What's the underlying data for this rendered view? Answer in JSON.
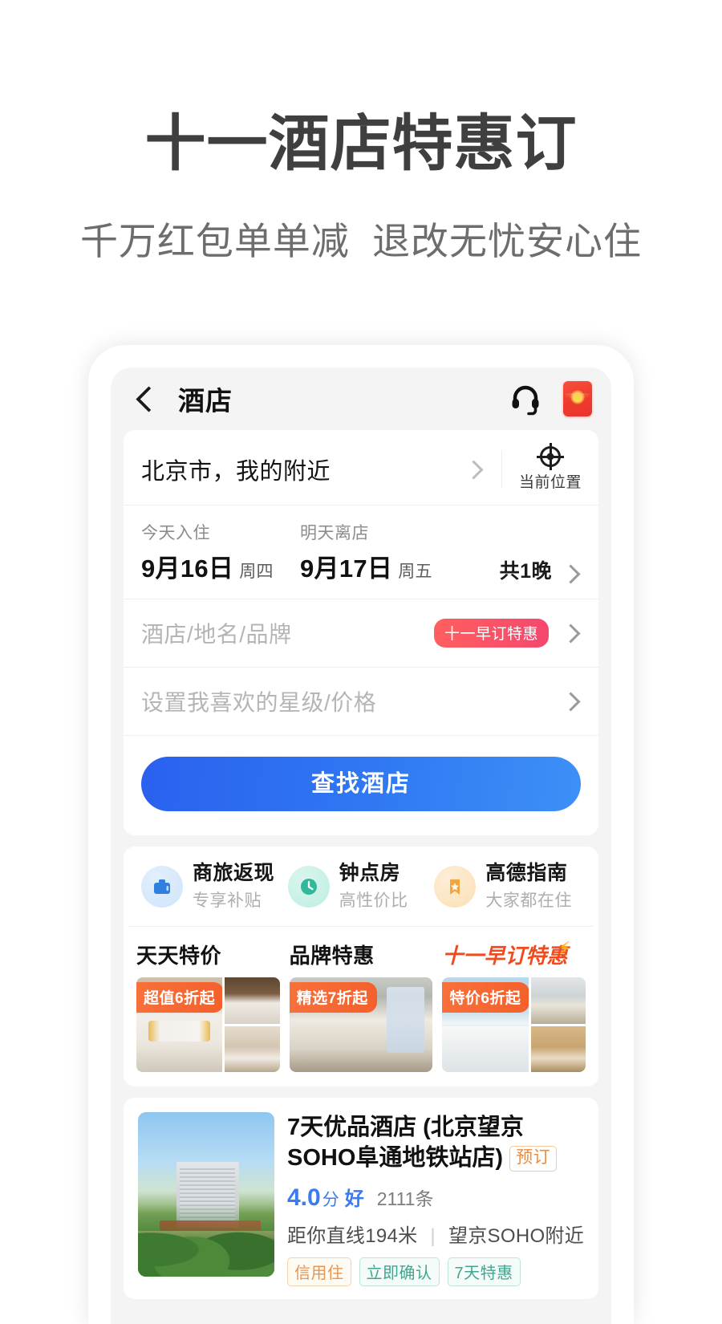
{
  "hero": {
    "title": "十一酒店特惠订",
    "subtitle": "千万红包单单减  退改无忧安心住"
  },
  "appbar": {
    "title": "酒店",
    "back_icon": "back-arrow-icon",
    "service_icon": "headset-icon",
    "redpacket_icon": "red-envelope-icon"
  },
  "search_panel": {
    "city": "北京市，我的附近",
    "current_location_label": "当前位置",
    "checkin": {
      "caption": "今天入住",
      "date": "9月16日",
      "weekday": "周四"
    },
    "checkout": {
      "caption": "明天离店",
      "date": "9月17日",
      "weekday": "周五"
    },
    "nights": "共1晚",
    "keyword_placeholder": "酒店/地名/品牌",
    "keyword_badge": "十一早订特惠",
    "filter_placeholder": "设置我喜欢的星级/价格",
    "submit_label": "查找酒店",
    "accent_blue": "#2a61ef",
    "badge_red": "#f4486f"
  },
  "services": [
    {
      "title": "商旅返现",
      "sub": "专享补贴",
      "icon": "briefcase-icon",
      "color": "#3a86e8"
    },
    {
      "title": "钟点房",
      "sub": "高性价比",
      "icon": "clock-icon",
      "color": "#2fb99a"
    },
    {
      "title": "高德指南",
      "sub": "大家都在住",
      "icon": "bookmark-star-icon",
      "color": "#f0a53e"
    }
  ],
  "promos": [
    {
      "heading": "天天特价",
      "badge": "超值6折起",
      "hot": false
    },
    {
      "heading": "品牌特惠",
      "badge": "精选7折起",
      "hot": false
    },
    {
      "heading": "十一早订特惠",
      "badge": "特价6折起",
      "hot": true,
      "hot_color": "#f04b1e"
    }
  ],
  "hotel": {
    "name": "7天优品酒店 (北京望京SOHO阜通地铁站店)",
    "book_tag": "预订",
    "rating": "4.0",
    "rating_unit": "分",
    "rating_word": "好",
    "review_count": "2111条",
    "distance": "距你直线194米",
    "landmark": "望京SOHO附近",
    "tags": [
      "信用住",
      "立即确认",
      "7天特惠"
    ]
  }
}
